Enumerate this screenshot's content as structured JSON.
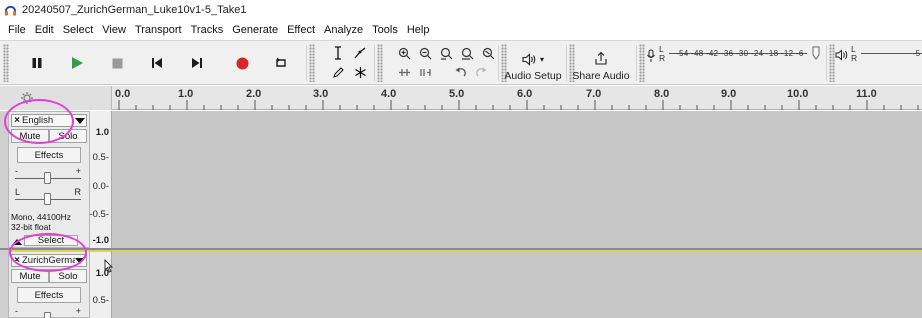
{
  "window": {
    "title": "20240507_ZurichGerman_Luke10v1-5_Take1"
  },
  "menu": {
    "items": [
      "File",
      "Edit",
      "Select",
      "View",
      "Transport",
      "Tracks",
      "Generate",
      "Effect",
      "Analyze",
      "Tools",
      "Help"
    ]
  },
  "toolbar": {
    "transport": {
      "pause": "pause-icon",
      "play": "play-icon",
      "stop": "stop-icon",
      "skip_start": "skip-to-start-icon",
      "skip_end": "skip-to-end-icon",
      "record": "record-icon",
      "loop": "loop-icon"
    },
    "audio_setup_label": "Audio Setup",
    "share_audio_label": "Share Audio",
    "record_meter": {
      "channels": [
        "L",
        "R"
      ],
      "scale": "-54 -48 -42 -36 -30 -24 -18 -12 -6"
    },
    "playback_meter": {
      "channels": [
        "L",
        "R"
      ],
      "scale": "-5"
    },
    "colors": {
      "play": "#2f9e44",
      "record": "#d62828",
      "transport_dark": "#1c1c1c",
      "stop": "#9a9a9a"
    }
  },
  "ruler": {
    "labels": [
      "0.0",
      "1.0",
      "2.0",
      "3.0",
      "4.0",
      "5.0",
      "6.0",
      "7.0",
      "8.0",
      "9.0",
      "10.0",
      "11.0"
    ]
  },
  "tracks": [
    {
      "name": "English",
      "mute_label": "Mute",
      "solo_label": "Solo",
      "effects_label": "Effects",
      "gain_minus": "-",
      "gain_plus": "+",
      "pan_left": "L",
      "pan_right": "R",
      "info_line1": "Mono, 44100Hz",
      "info_line2": "32-bit float",
      "select_label": "Select",
      "scale": [
        "1.0",
        "0.5-",
        "0.0-",
        "-0.5-",
        "-1.0"
      ]
    },
    {
      "name": "ZurichGerma",
      "mute_label": "Mute",
      "solo_label": "Solo",
      "effects_label": "Effects",
      "gain_minus": "-",
      "gain_plus": "+",
      "scale": [
        "1.0",
        "0.5-"
      ]
    }
  ],
  "annotations": {
    "color": "#e040d8"
  }
}
